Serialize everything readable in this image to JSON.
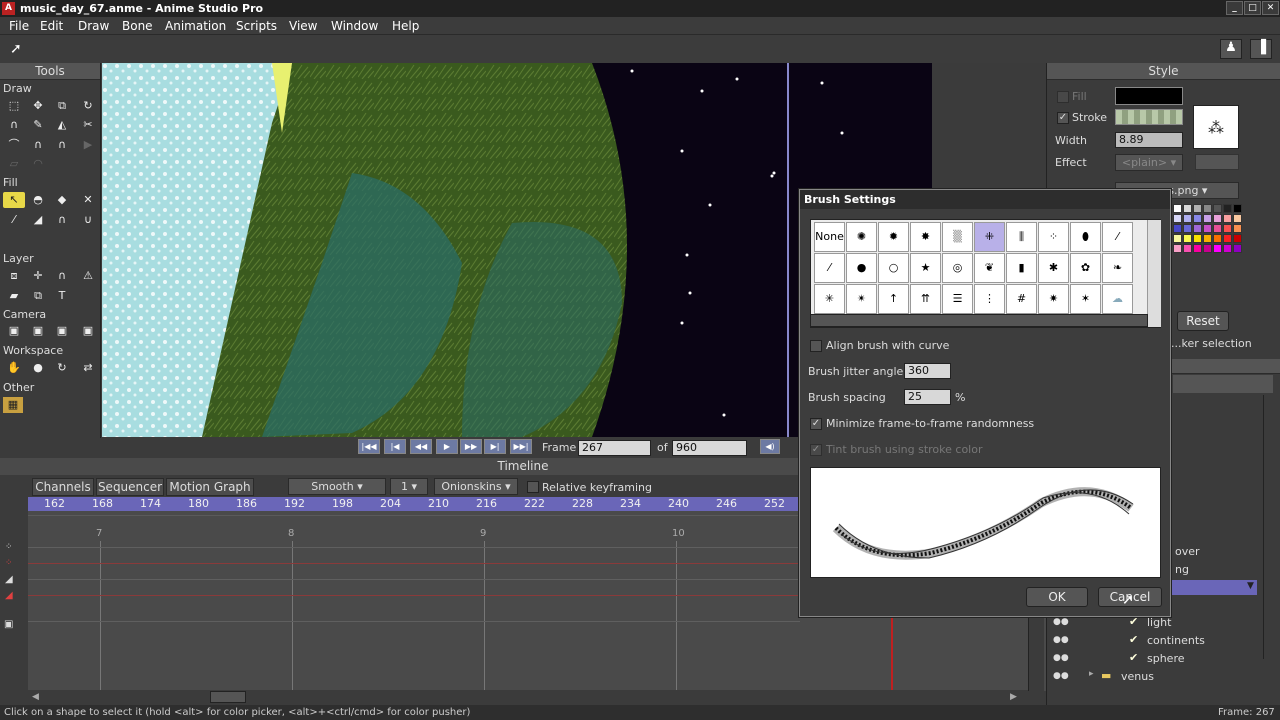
{
  "window": {
    "title": "music_day_67.anme - Anime Studio Pro",
    "app_icon": "A",
    "min": "_",
    "max": "□",
    "close": "✕"
  },
  "menu": [
    "File",
    "Edit",
    "Draw",
    "Bone",
    "Animation",
    "Scripts",
    "View",
    "Window",
    "Help"
  ],
  "tools": {
    "header": "Tools",
    "sections": {
      "draw": "Draw",
      "fill": "Fill",
      "layer": "Layer",
      "camera": "Camera",
      "workspace": "Workspace",
      "other": "Other"
    }
  },
  "playback": {
    "frame_label": "Frame",
    "frame_value": "267",
    "of_label": "of",
    "total_value": "960"
  },
  "timeline": {
    "header": "Timeline",
    "tabs": [
      "Channels",
      "Sequencer",
      "Motion Graph"
    ],
    "interp": "Smooth",
    "interp_step": "1",
    "onionskins": "Onionskins",
    "relative_label": "Relative keyframing",
    "ruler": [
      "162",
      "168",
      "174",
      "180",
      "186",
      "192",
      "198",
      "204",
      "210",
      "216",
      "222",
      "228",
      "234",
      "240",
      "246",
      "252"
    ],
    "markers": [
      "7",
      "8",
      "9",
      "10"
    ]
  },
  "style_panel": {
    "header": "Style",
    "fill_label": "Fill",
    "stroke_label": "Stroke",
    "width_label": "Width",
    "width_value": "8.89",
    "effect_label": "Effect",
    "effect_value": "<plain>",
    "palette_file": "...ors.png",
    "reset_label": "Reset",
    "picker_label": "...ker selection",
    "swatch_colors": [
      "#ffffff",
      "#d8d8d8",
      "#b0b0b0",
      "#888888",
      "#555555",
      "#222222",
      "#000000",
      "#d8d8f8",
      "#b0b0f0",
      "#8888e8",
      "#c8a0e8",
      "#e8a0d8",
      "#f8a0a0",
      "#f8c8a0",
      "#4848c8",
      "#6868d8",
      "#a068d8",
      "#c850c8",
      "#e85098",
      "#f85050",
      "#f89050",
      "#f8f8a0",
      "#f8f850",
      "#f8e000",
      "#f8b000",
      "#f87000",
      "#f82020",
      "#c80000",
      "#f8a0c8",
      "#f850b0",
      "#f800a0",
      "#c80090",
      "#ff00ff",
      "#d000d0",
      "#9000c0"
    ]
  },
  "layers": {
    "over_label": "over",
    "ng_label": "ng",
    "items": [
      "light",
      "continents",
      "sphere",
      "venus"
    ]
  },
  "dialog": {
    "title": "Brush Settings",
    "none_label": "None",
    "align_label": "Align brush with curve",
    "jitter_label": "Brush jitter angle",
    "jitter_value": "360",
    "spacing_label": "Brush spacing",
    "spacing_value": "25",
    "spacing_unit": "%",
    "minimize_label": "Minimize frame-to-frame randomness",
    "tint_label": "Tint brush using stroke color",
    "ok_label": "OK",
    "cancel_label": "Cancel"
  },
  "status": {
    "message": "Click on a shape to select it (hold <alt> for color picker, <alt>+<ctrl/cmd> for color pusher)",
    "frame": "Frame: 267"
  }
}
